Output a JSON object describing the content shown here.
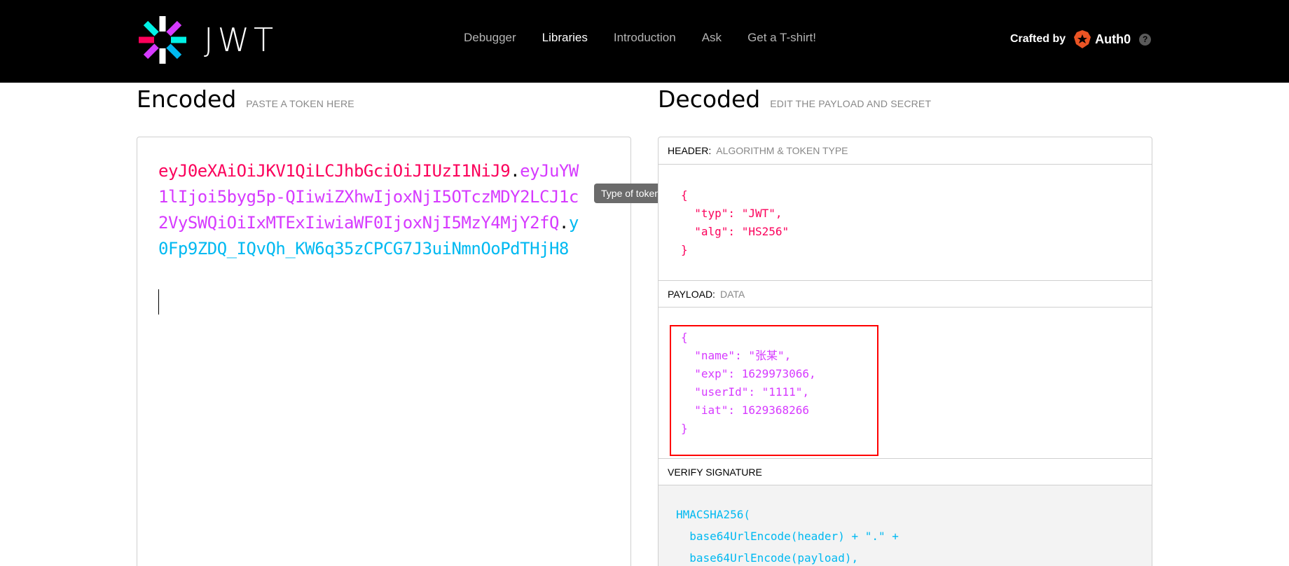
{
  "navbar": {
    "logo_text": "JWT",
    "links": [
      {
        "label": "Debugger"
      },
      {
        "label": "Libraries"
      },
      {
        "label": "Introduction"
      },
      {
        "label": "Ask"
      },
      {
        "label": "Get a T-shirt!"
      }
    ],
    "active_link": "Libraries",
    "crafted_by_label": "Crafted by",
    "brand_name": "Auth0",
    "help_icon": "?"
  },
  "encoded": {
    "title": "Encoded",
    "subtitle": "PASTE A TOKEN HERE",
    "token": {
      "header_part": "eyJ0eXAiOiJKV1QiLCJhbGciOiJIUzI1NiJ9",
      "dot1": ".",
      "payload_part": "eyJuYW1lIjoi5byg5p-QIiwiZXhwIjoxNjI5OTczMDY2LCJ1c2VySWQiOiIxMTExIiwiaWF0IjoxNjI5MzY4MjY2fQ",
      "dot2": ".",
      "signature_part": "y0Fp9ZDQ_IQvQh_KW6q35zCPCG7J3uiNmnOoPdTHjH8"
    }
  },
  "decoded": {
    "title": "Decoded",
    "subtitle": "EDIT THE PAYLOAD AND SECRET",
    "header_section": {
      "label": "HEADER:",
      "desc": "ALGORITHM & TOKEN TYPE",
      "json": "{\n  \"typ\": \"JWT\",\n  \"alg\": \"HS256\"\n}"
    },
    "payload_section": {
      "label": "PAYLOAD:",
      "desc": "DATA",
      "json": "{\n  \"name\": \"张某\",\n  \"exp\": 1629973066,\n  \"userId\": \"1111\",\n  \"iat\": 1629368266\n}"
    },
    "verify_section": {
      "label": "VERIFY SIGNATURE",
      "code": "HMACSHA256(\n  base64UrlEncode(header) + \".\" +\n  base64UrlEncode(payload),"
    }
  },
  "tooltip": {
    "text": "Type of token"
  },
  "colors": {
    "header": "#fb015b",
    "payload": "#d63aff",
    "signature": "#00b9f1",
    "highlight": "#ff0000"
  }
}
